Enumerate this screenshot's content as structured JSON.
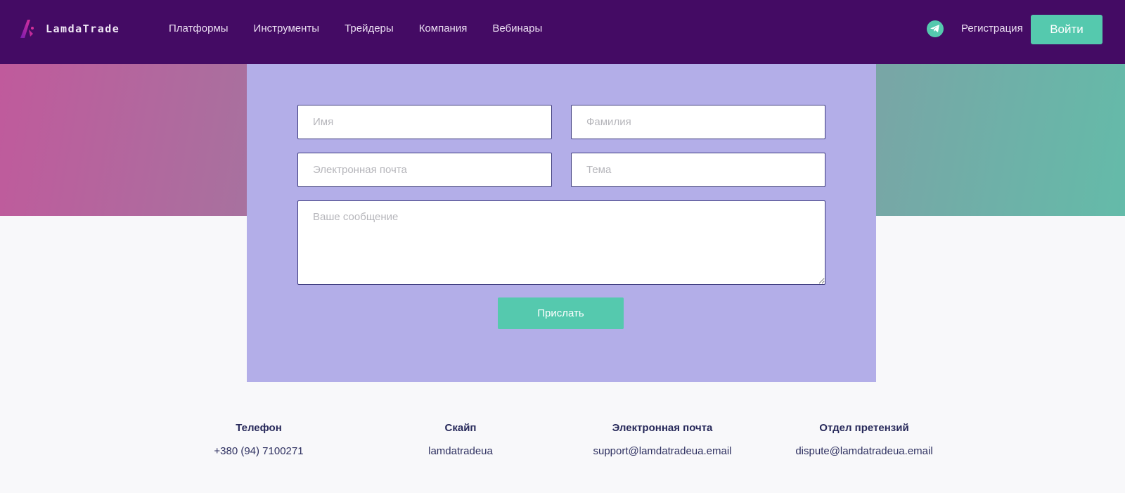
{
  "header": {
    "logo": "LamdaTrade",
    "nav": [
      "Платформы",
      "Инструменты",
      "Трейдеры",
      "Компания",
      "Вебинары"
    ],
    "register": "Регистрация",
    "login": "Войти"
  },
  "form": {
    "first_name_placeholder": "Имя",
    "last_name_placeholder": "Фамилия",
    "email_placeholder": "Электронная почта",
    "subject_placeholder": "Тема",
    "message_placeholder": "Ваше сообщение",
    "submit": "Прислать"
  },
  "contacts": [
    {
      "title": "Телефон",
      "value": "+380 (94) 7100271"
    },
    {
      "title": "Скайп",
      "value": "lamdatradeua"
    },
    {
      "title": "Электронная почта",
      "value": "support@lamdatradeua.email"
    },
    {
      "title": "Отдел претензий",
      "value": "dispute@lamdatradeua.email"
    }
  ],
  "colors": {
    "header": "#440b64",
    "accent": "#55c9ae",
    "panel": "#b3aee8"
  }
}
